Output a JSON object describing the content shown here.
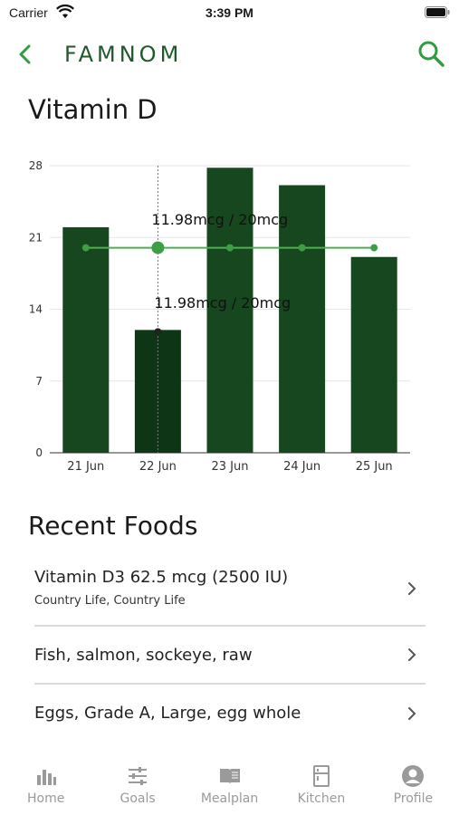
{
  "status_bar": {
    "carrier": "Carrier",
    "time": "3:39 PM"
  },
  "nav": {
    "brand": "FAMNOM",
    "back_icon": "chevron-left-icon",
    "search_icon": "search-icon"
  },
  "page_title": "Vitamin D",
  "colors": {
    "brand_green": "#1e5a2a",
    "bar_green": "#17471f",
    "bar_selected": "#0f3517",
    "goal_line": "#4caf50",
    "tab_gray": "#9a9a9a"
  },
  "chart_data": {
    "type": "bar",
    "categories": [
      "21 Jun",
      "22 Jun",
      "23 Jun",
      "24 Jun",
      "25 Jun"
    ],
    "values": [
      22,
      11.98,
      27.8,
      26.1,
      19.1
    ],
    "goal": [
      20,
      20,
      20,
      20,
      20
    ],
    "ylim": [
      0,
      28
    ],
    "yticks": [
      "0",
      "7",
      "14",
      "21",
      "28"
    ],
    "grid": true,
    "selected_index": 1,
    "annotations": [
      "11.98mcg / 20mcg",
      "11.98mcg / 20mcg"
    ]
  },
  "recent": {
    "title": "Recent Foods",
    "items": [
      {
        "name": "Vitamin D3 62.5 mcg (2500 IU)",
        "brand": "Country Life, Country Life"
      },
      {
        "name": "Fish, salmon, sockeye, raw"
      },
      {
        "name": "Eggs, Grade A, Large, egg whole"
      }
    ]
  },
  "tabs": [
    {
      "label": "Home",
      "icon": "bar-chart-icon"
    },
    {
      "label": "Goals",
      "icon": "sliders-icon"
    },
    {
      "label": "Mealplan",
      "icon": "book-icon"
    },
    {
      "label": "Kitchen",
      "icon": "fridge-icon"
    },
    {
      "label": "Profile",
      "icon": "user-icon"
    }
  ]
}
